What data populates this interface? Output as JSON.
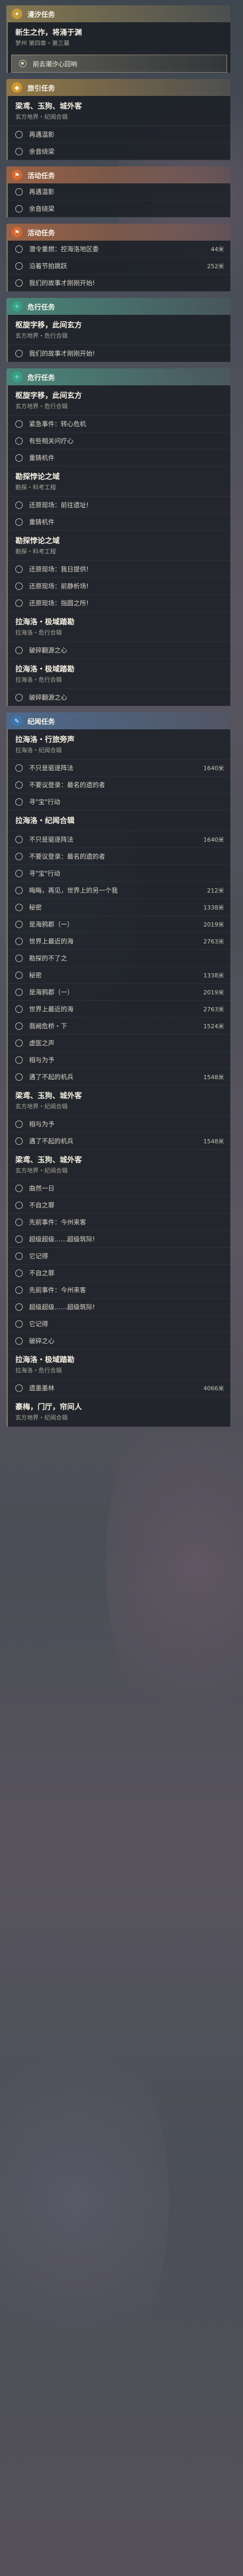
{
  "sections": [
    {
      "header": {
        "label": "漫汐任务",
        "accent": "gold",
        "icon": "star-icon"
      },
      "quests": [
        {
          "name": "新生之作，将涌于渊",
          "sub": "梦州 第四章・第三幕",
          "steps": [
            {
              "text": "前去潮汐心回响",
              "dist": "",
              "active": true
            }
          ]
        }
      ]
    },
    {
      "header": {
        "label": "旅引任务",
        "accent": "gold2",
        "icon": "pin-icon"
      },
      "quests": [
        {
          "name": "梁鸢、玉狗、城外客",
          "sub": "玄方地界・纪闻合辑",
          "steps": [
            {
              "text": "再遇温影",
              "dist": "",
              "active": false
            },
            {
              "text": "余音绕梁",
              "dist": "",
              "active": false
            }
          ]
        }
      ]
    },
    {
      "header": {
        "label": "活动任务",
        "accent": "orange",
        "icon": "flag-icon"
      },
      "quests": [
        {
          "name": "",
          "sub": "",
          "steps": [
            {
              "text": "再遇温影",
              "dist": "",
              "active": false
            },
            {
              "text": "余音绕梁",
              "dist": "",
              "active": false
            }
          ]
        }
      ]
    },
    {
      "header": {
        "label": "活动任务",
        "accent": "orange",
        "icon": "flag-icon"
      },
      "quests": [
        {
          "name": "",
          "sub": "",
          "steps": [
            {
              "text": "潜令重燃：控海洛地区委",
              "dist": "44米",
              "active": false
            },
            {
              "text": "沿着节拍跳跃",
              "dist": "252米",
              "active": false
            },
            {
              "text": "我们的故事才刚刚开始!",
              "dist": "",
              "active": false
            }
          ]
        }
      ]
    },
    {
      "header": {
        "label": "危行任务",
        "accent": "teal",
        "icon": "compass-icon"
      },
      "quests": [
        {
          "name": "枢旋字移，此间玄方",
          "sub": "玄方地界・危行合辑",
          "steps": [
            {
              "text": "我们的故事才刚刚开始!",
              "dist": "",
              "active": false
            }
          ]
        }
      ]
    },
    {
      "header": {
        "label": "危行任务",
        "accent": "teal",
        "icon": "compass-icon"
      },
      "quests": [
        {
          "name": "枢旋字移，此间玄方",
          "sub": "玄方地界・危行合辑",
          "steps": [
            {
              "text": "紧急事件：转心危机",
              "dist": "",
              "active": false
            },
            {
              "text": "有些相关问疗心",
              "dist": "",
              "active": false
            },
            {
              "text": "重铸机件",
              "dist": "",
              "active": false
            }
          ]
        },
        {
          "name": "勘探悖论之域",
          "sub": "勘探・科考工程",
          "steps": [
            {
              "text": "还原现场：前往遗址!",
              "dist": "",
              "active": false
            },
            {
              "text": "重铸机件",
              "dist": "",
              "active": false
            }
          ]
        },
        {
          "name": "勘探悖论之域",
          "sub": "勘探・科考工程",
          "steps": [
            {
              "text": "还原现场：我日提供!",
              "dist": "",
              "active": false
            },
            {
              "text": "还原现场：前静析场!",
              "dist": "",
              "active": false
            },
            {
              "text": "还原现场：指圆之所!",
              "dist": "",
              "active": false
            }
          ]
        },
        {
          "name": "拉海洛・极域踏勘",
          "sub": "拉海洛・危行合辑",
          "steps": [
            {
              "text": "破碎翻源之心",
              "dist": "",
              "active": false
            }
          ]
        },
        {
          "name": "拉海洛・极域踏勘",
          "sub": "拉海洛・危行合辑",
          "steps": [
            {
              "text": "破碎翻源之心",
              "dist": "",
              "active": false
            }
          ]
        }
      ]
    },
    {
      "header": {
        "label": "纪闻任务",
        "accent": "blue",
        "icon": "book-icon"
      },
      "quests": [
        {
          "name": "拉海洛・行旅旁声",
          "sub": "拉海洛・纪闻合辑",
          "steps": [
            {
              "text": "不只是驱逐阵法",
              "dist": "1640米",
              "active": false
            },
            {
              "text": "不要议登录：最名的遗的者",
              "dist": "",
              "active": false
            },
            {
              "text": "寻\"宝\"行动",
              "dist": "",
              "active": false
            }
          ]
        },
        {
          "name": "拉海洛・纪闻合辑",
          "sub": "",
          "steps": [
            {
              "text": "不只是驱逐阵法",
              "dist": "1640米",
              "active": false
            },
            {
              "text": "不要议登录：最名的遗的者",
              "dist": "",
              "active": false
            },
            {
              "text": "寻\"宝\"行动",
              "dist": "",
              "active": false
            },
            {
              "text": "晦晦，再见，世界上的另一个我",
              "dist": "212米",
              "active": false
            },
            {
              "text": "秘密",
              "dist": "1338米",
              "active": false
            },
            {
              "text": "是海鸦郡（一）",
              "dist": "2019米",
              "active": false
            },
            {
              "text": "世界上最近的海",
              "dist": "2763米",
              "active": false
            },
            {
              "text": "勘探的不了之",
              "dist": "",
              "active": false
            }
          ]
        },
        {
          "name": "",
          "sub": "",
          "steps": [
            {
              "text": "秘密",
              "dist": "1338米",
              "active": false
            },
            {
              "text": "是海鸦郡（一）",
              "dist": "2019米",
              "active": false
            },
            {
              "text": "世界上最近的海",
              "dist": "2763米",
              "active": false
            },
            {
              "text": "翡阙危桥・下",
              "dist": "1524米",
              "active": false
            },
            {
              "text": "虚医之声",
              "dist": "",
              "active": false
            },
            {
              "text": "相与为予",
              "dist": "",
              "active": false
            },
            {
              "text": "遇了不起的机兵",
              "dist": "1548米",
              "active": false
            }
          ]
        },
        {
          "name": "梁鸢、玉狗、城外客",
          "sub": "玄方地界・纪闻合辑",
          "steps": []
        },
        {
          "name": "",
          "sub": "",
          "steps": [
            {
              "text": "相与为予",
              "dist": "",
              "active": false
            },
            {
              "text": "遇了不起的机兵",
              "dist": "1548米",
              "active": false
            }
          ]
        },
        {
          "name": "梁鸢、玉狗、城外客",
          "sub": "玄方地界・纪闻合辑",
          "steps": [
            {
              "text": "曲然一日",
              "dist": "",
              "active": false
            },
            {
              "text": "不自之罪",
              "dist": "",
              "active": false
            },
            {
              "text": "先前事件：今州来客",
              "dist": "",
              "active": false
            },
            {
              "text": "超级超级……超级筑际!",
              "dist": "",
              "active": false
            },
            {
              "text": "它记得",
              "dist": "",
              "active": false
            }
          ]
        },
        {
          "name": "",
          "sub": "",
          "steps": [
            {
              "text": "不自之罪",
              "dist": "",
              "active": false
            },
            {
              "text": "先前事件：今州来客",
              "dist": "",
              "active": false
            },
            {
              "text": "超级超级……超级筑际!",
              "dist": "",
              "active": false
            },
            {
              "text": "它记得",
              "dist": "",
              "active": false
            },
            {
              "text": "破碎之心",
              "dist": "",
              "active": false
            }
          ]
        },
        {
          "name": "拉海洛・极域踏勘",
          "sub": "拉海洛・危行合辑",
          "steps": [
            {
              "text": "遗墨墨林",
              "dist": "4066米",
              "active": false
            }
          ]
        },
        {
          "name": "豪梅，门厅，帘间人",
          "sub": "玄方地界・纪闻合辑",
          "steps": []
        }
      ]
    }
  ]
}
